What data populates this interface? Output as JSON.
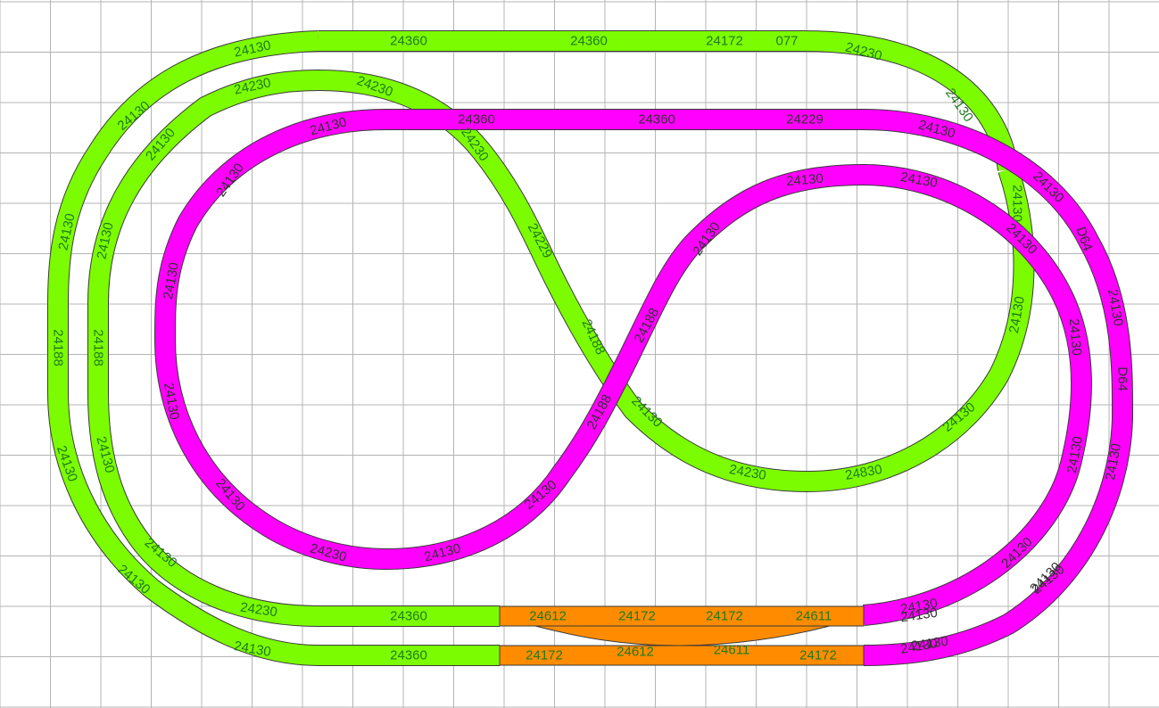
{
  "colors": {
    "grid": "#b4b4b4",
    "green": "#7cfc00",
    "magenta": "#ff00ff",
    "orange": "#ff8c00",
    "outline": "#3a3a3a",
    "label": "#1e7a1e",
    "label_on_magenta": "#333333"
  },
  "labels": {
    "g_top_1": "24360",
    "g_top_2": "24360",
    "g_top_3": "24172",
    "g_top_4": "077",
    "g_tl_1": "24130",
    "g_tl_2": "24130",
    "g_tl_3": "24130",
    "g_left_s": "24188",
    "g_bl_1": "24130",
    "g_bl_2": "24130",
    "g_bl_3": "24130",
    "g_bot_1": "24360",
    "g_tr_1": "24230",
    "g_tr_2": "24130",
    "gi_t1": "24230",
    "gi_t2": "24230",
    "gi_c1": "24130",
    "gi_c2": "24130",
    "gi_l": "24188",
    "gi_bl1": "24130",
    "gi_bl2": "24130",
    "gi_bl3": "24230",
    "gi_bot": "24360",
    "gi_s1": "24230",
    "gi_s2": "24229",
    "gi_s3": "24188",
    "gi_x1": "24130",
    "gi_b1": "24230",
    "gi_b2": "24830",
    "gi_r1": "24130",
    "gi_r2": "24130",
    "gi_r3": "24130",
    "m_top_1": "24360",
    "m_top_2": "24360",
    "m_top_3": "24229",
    "m_tl_1": "24130",
    "m_tl_2": "24130",
    "m_l": "24130",
    "m_l2": "24130",
    "m_bl_1": "24130",
    "m_bot_1": "24230",
    "m_bot_2": "24130",
    "m_cx1": "24188",
    "m_cx2": "24188",
    "m_cx3": "24130",
    "m_cx4": "24130",
    "m_ct1": "24130",
    "m_ct2": "24130",
    "m_cr1": "24130",
    "m_cr2": "24130",
    "m_r1": "24130",
    "m_r2": "24130",
    "m_r3": "24130",
    "m_r4": "24130",
    "m_tr1": "24130",
    "m_tr2": "24130",
    "m_d1": "D64",
    "m_d2": "D64",
    "m_or1": "24130",
    "m_or2": "24130",
    "m_or3": "24130",
    "m_or4": "24130",
    "m_b1": "24130",
    "m_b2": "24130",
    "o_1": "24612",
    "o_2": "24172",
    "o_3": "24172",
    "o_4": "24611",
    "o_5": "24172",
    "o_6": "24612",
    "o_7": "24611",
    "o_8": "24172"
  }
}
